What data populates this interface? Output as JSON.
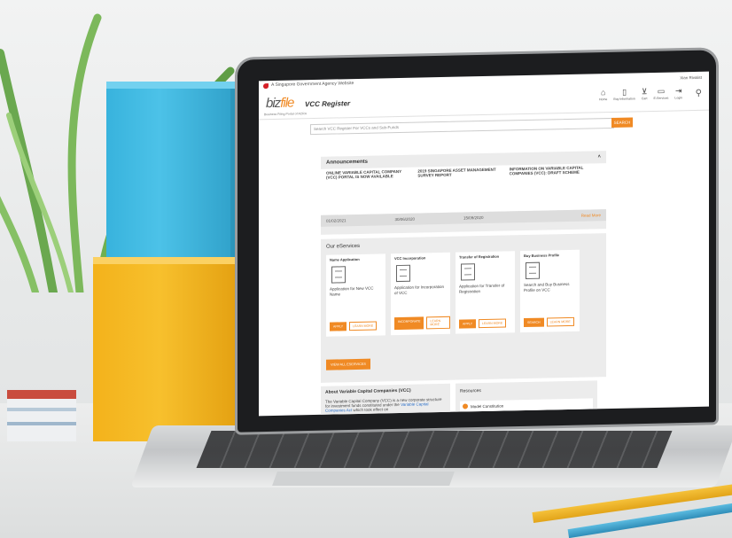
{
  "site": {
    "gov_banner": "A Singapore Government Agency Website",
    "user_greeting": "Xian Rivalist",
    "logo_main": "biz",
    "logo_accent": "file",
    "logo_sub": "Business Filing Portal of ACRA",
    "page_title": "VCC Register"
  },
  "nav_icons": [
    {
      "label": "Home",
      "icon": "home-icon",
      "glyph": "⌂"
    },
    {
      "label": "Buy Information",
      "icon": "document-icon",
      "glyph": "▯"
    },
    {
      "label": "Cart",
      "icon": "cart-icon",
      "glyph": "⊻"
    },
    {
      "label": "E-Services",
      "icon": "eservices-icon",
      "glyph": "▭"
    },
    {
      "label": "Login",
      "icon": "login-icon",
      "glyph": "⇥"
    }
  ],
  "search": {
    "placeholder": "Search VCC Register For VCCs and Sub-Funds",
    "button_label": "SEARCH"
  },
  "announcements": {
    "heading": "Announcements",
    "items": [
      {
        "title": "ONLINE VARIABLE CAPITAL COMPANY (VCC) PORTAL IS NOW AVAILABLE",
        "date": "01/02/2021"
      },
      {
        "title": "2019 SINGAPORE ASSET MANAGEMENT SURVEY REPORT",
        "date": "30/06/2020"
      },
      {
        "title": "INFORMATION ON VARIABLE CAPITAL COMPANIES (VCC): DRAFT SCHEME",
        "date": "15/09/2020"
      }
    ],
    "read_more": "Read More"
  },
  "eservices": {
    "heading": "Our eServices",
    "cards": [
      {
        "title": "Name Application",
        "desc": "Application for New VCC Name",
        "primary": "APPLY",
        "secondary": "LEARN MORE"
      },
      {
        "title": "VCC Incorporation",
        "desc": "Application for Incorporation of VCC",
        "primary": "INCORPORATE",
        "secondary": "LEARN MORE"
      },
      {
        "title": "Transfer of Registration",
        "desc": "Application for Transfer of Registration",
        "primary": "APPLY",
        "secondary": "LEARN MORE"
      },
      {
        "title": "Buy Business Profile",
        "desc": "Search and Buy Business Profile on VCC",
        "primary": "SEARCH",
        "secondary": "LEARN MORE"
      }
    ],
    "all_button": "VIEW ALL ESERVICES"
  },
  "about": {
    "heading": "About Variable Capital Companies (VCC)",
    "text_before": "The Variable Capital Company (VCC) is a new corporate structure for investment funds constituted under the",
    "link": "Variable Capital Companies Act",
    "text_after": "which took effect on"
  },
  "resources": {
    "heading": "Resources",
    "item": "Model Constitution"
  }
}
